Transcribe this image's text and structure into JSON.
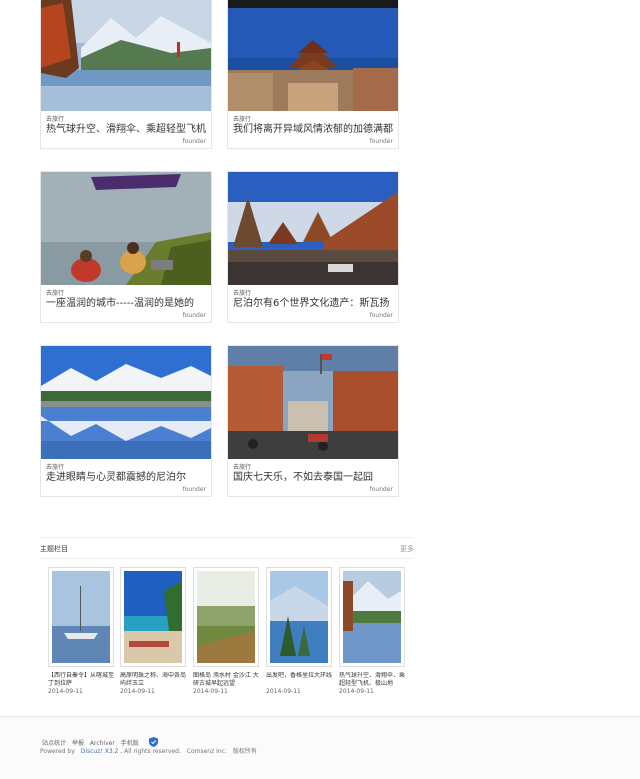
{
  "articles": [
    {
      "category": "去旅行",
      "title": "热气球升空、滑翔伞、乘超轻型飞机",
      "author": "founder"
    },
    {
      "category": "去旅行",
      "title": "我们将离开异域风情浓郁的加德满都",
      "author": "founder"
    },
    {
      "category": "去旅行",
      "title": "一座温润的城市-----温润的是她的",
      "author": "founder"
    },
    {
      "category": "去旅行",
      "title": "尼泊尔有6个世界文化遗产：斯瓦扬",
      "author": "founder"
    },
    {
      "category": "去旅行",
      "title": "走进眼睛与心灵都震撼的尼泊尔",
      "author": "founder"
    },
    {
      "category": "去旅行",
      "title": "国庆七天乐，不如去泰国一起囧",
      "author": "founder"
    }
  ],
  "topic": {
    "title": "主题栏目",
    "more": "更多",
    "items": [
      {
        "title": "【西行自秦令】从喀城至丁到拉萨",
        "date": "2014-09-11"
      },
      {
        "title": "高原明珠之称、海中各岛屿绊玉立",
        "date": "2014-09-11"
      },
      {
        "title": "图格岛 添水村 金沙江 大研古城早起远望",
        "date": "2014-09-11"
      },
      {
        "title": "出发吧，香格里拉大环线",
        "date": "2014-09-11"
      },
      {
        "title": "热气球升空、滑翔伞、乘超轻型飞机、极山地",
        "date": "2014-09-11"
      }
    ]
  },
  "footer": {
    "links": [
      "站点统计",
      "举报",
      "Archiver",
      "手机版"
    ],
    "powered_by": "Powered by",
    "discuz": "Discuz!",
    "version": "X3.2",
    "rights": ", All rights reserved.",
    "comsenz": "Comsenz Inc.",
    "copyright": "版权所有"
  }
}
